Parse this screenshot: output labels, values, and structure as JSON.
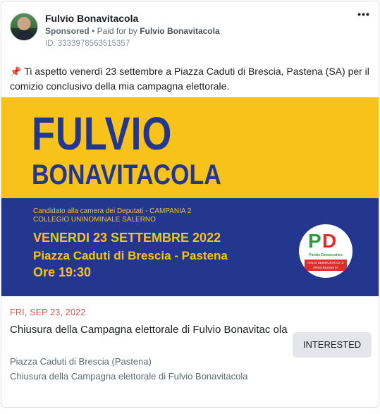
{
  "ad": {
    "page_name": "Fulvio Bonavitacola",
    "sponsored": "Sponsored",
    "separator": "•",
    "paid_for_by": "Paid for by",
    "payer": "Fulvio Bonavitacola",
    "id_text": "ID: 3333978563515357",
    "more_label": "•••"
  },
  "post": {
    "pin_icon": "📌",
    "text": "Ti aspetto venerdì 23 settembre a Piazza Caduti di Brescia, Pastena (SA) per il comizio conclusivo della mia campagna elettorale."
  },
  "banner": {
    "name_line1": "FULVIO",
    "name_line2": "BONAVITACOLA",
    "candidate_line1": "Candidato alla camera dei Deputati - CAMPANIA 2",
    "candidate_line2": "COLLEGIO UNINOMINALE SALERNO",
    "date": "VENERDI 23 SETTEMBRE 2022",
    "place": "Piazza Caduti di Brescia - Pastena",
    "time": "Ore  19:30",
    "logo": {
      "letter1": "P",
      "letter2": "D",
      "name": "Partito Democratico",
      "band": "ITALIA DEMOCRATICA E PROGRESSISTA"
    },
    "colors": {
      "yellow": "#f7c21a",
      "blue": "#24378e",
      "pd_green": "#2e9a3e",
      "pd_red": "#e22b2b"
    }
  },
  "event": {
    "date": "FRI, SEP 23, 2022",
    "title": "Chiusura della Campagna elettorale di Fulvio Bonavitac ola",
    "place": "Piazza Caduti di Brescia (Pastena)",
    "description": "Chiusura della Campagna elettorale di Fulvio Bonavitacola",
    "interested_label": "INTERESTED"
  }
}
